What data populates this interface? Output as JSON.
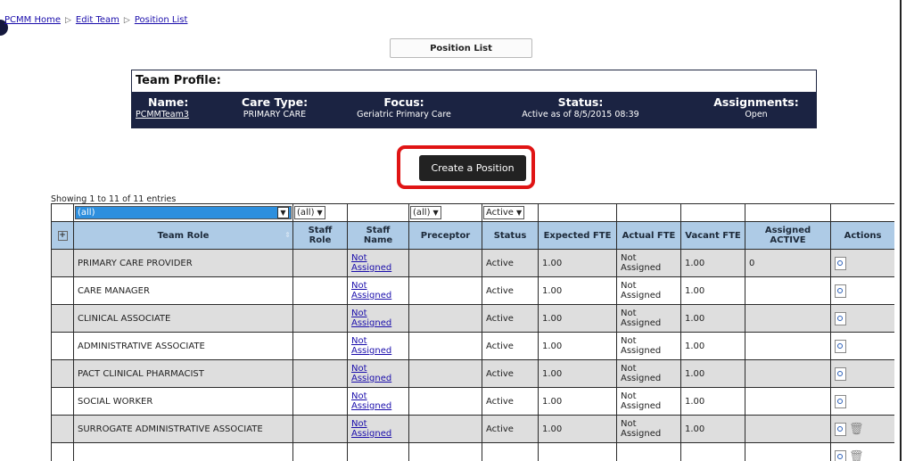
{
  "breadcrumb": {
    "items": [
      "PCMM Home",
      "Edit Team",
      "Position List"
    ]
  },
  "header": {
    "position_list_button": "Position List"
  },
  "team_profile": {
    "title": "Team Profile:",
    "name_label": "Name:",
    "name_value": "PCMMTeam3",
    "care_type_label": "Care Type:",
    "care_type_value": "PRIMARY CARE",
    "focus_label": "Focus:",
    "focus_value": "Geriatric Primary Care",
    "status_label": "Status:",
    "status_value": "Active as of 8/5/2015 08:39",
    "assignments_label": "Assignments:",
    "assignments_value": "Open"
  },
  "create_button": "Create a Position",
  "showing_text": "Showing 1 to 11 of 11 entries",
  "filters": {
    "team_role": "(all)",
    "staff_role": "(all)",
    "preceptor": "(all)",
    "status": "Active"
  },
  "columns": [
    "Team Role",
    "Staff Role",
    "Staff Name",
    "Preceptor",
    "Status",
    "Expected FTE",
    "Actual FTE",
    "Vacant FTE",
    "Assigned ACTIVE",
    "Actions"
  ],
  "rows": [
    {
      "role": "PRIMARY CARE PROVIDER",
      "staff_role": "",
      "staff_name": "Not Assigned",
      "preceptor": "",
      "status": "Active",
      "expected": "1.00",
      "actual": "Not Assigned",
      "vacant": "1.00",
      "assigned": "0",
      "delete": false
    },
    {
      "role": "CARE MANAGER",
      "staff_role": "",
      "staff_name": "Not Assigned",
      "preceptor": "",
      "status": "Active",
      "expected": "1.00",
      "actual": "Not Assigned",
      "vacant": "1.00",
      "assigned": "",
      "delete": false
    },
    {
      "role": "CLINICAL ASSOCIATE",
      "staff_role": "",
      "staff_name": "Not Assigned",
      "preceptor": "",
      "status": "Active",
      "expected": "1.00",
      "actual": "Not Assigned",
      "vacant": "1.00",
      "assigned": "",
      "delete": false
    },
    {
      "role": "ADMINISTRATIVE ASSOCIATE",
      "staff_role": "",
      "staff_name": "Not Assigned",
      "preceptor": "",
      "status": "Active",
      "expected": "1.00",
      "actual": "Not Assigned",
      "vacant": "1.00",
      "assigned": "",
      "delete": false
    },
    {
      "role": "PACT CLINICAL PHARMACIST",
      "staff_role": "",
      "staff_name": "Not Assigned",
      "preceptor": "",
      "status": "Active",
      "expected": "1.00",
      "actual": "Not Assigned",
      "vacant": "1.00",
      "assigned": "",
      "delete": false
    },
    {
      "role": "SOCIAL WORKER",
      "staff_role": "",
      "staff_name": "Not Assigned",
      "preceptor": "",
      "status": "Active",
      "expected": "1.00",
      "actual": "Not Assigned",
      "vacant": "1.00",
      "assigned": "",
      "delete": false
    },
    {
      "role": "SURROGATE ADMINISTRATIVE ASSOCIATE",
      "staff_role": "",
      "staff_name": "Not Assigned",
      "preceptor": "",
      "status": "Active",
      "expected": "1.00",
      "actual": "Not Assigned",
      "vacant": "1.00",
      "assigned": "",
      "delete": true
    },
    {
      "role": "",
      "staff_role": "",
      "staff_name": "",
      "preceptor": "",
      "status": "",
      "expected": "",
      "actual": "",
      "vacant": "",
      "assigned": "",
      "delete": true
    }
  ]
}
